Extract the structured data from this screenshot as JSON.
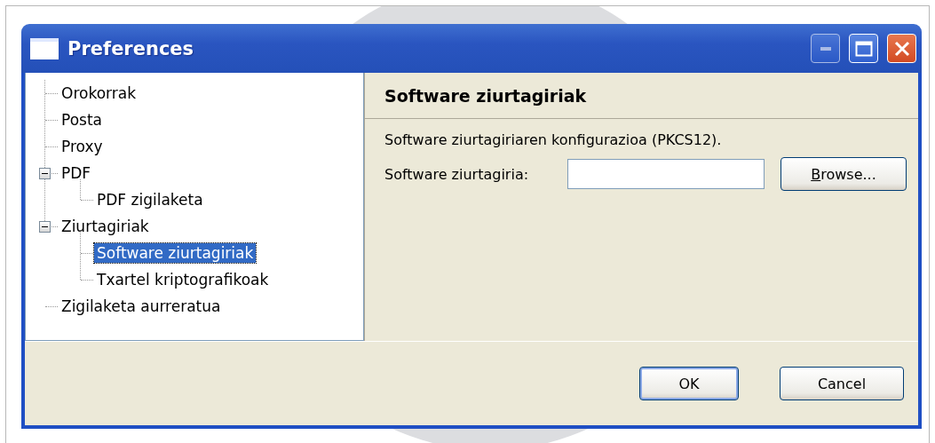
{
  "window": {
    "title": "Preferences"
  },
  "tree": [
    {
      "label": "Orokorrak",
      "selected": false
    },
    {
      "label": "Posta",
      "selected": false
    },
    {
      "label": "Proxy",
      "selected": false
    },
    {
      "label": "PDF",
      "selected": false,
      "expanded": true,
      "children": [
        {
          "label": "PDF zigilaketa",
          "selected": false
        }
      ]
    },
    {
      "label": "Ziurtagiriak",
      "selected": false,
      "expanded": true,
      "children": [
        {
          "label": "Software ziurtagiriak",
          "selected": true
        },
        {
          "label": "Txartel kriptografikoak",
          "selected": false
        }
      ]
    },
    {
      "label": "Zigilaketa aurreratua",
      "selected": false
    }
  ],
  "panel": {
    "title": "Software ziurtagiriak",
    "description": "Software ziurtagiriaren konfigurazioa (PKCS12).",
    "field": {
      "label": "Software ziurtagiria:"
    },
    "browse_button": "Browse..."
  },
  "buttons": [
    {
      "label": "OK",
      "default": true
    },
    {
      "label": "Cancel",
      "default": false
    }
  ]
}
